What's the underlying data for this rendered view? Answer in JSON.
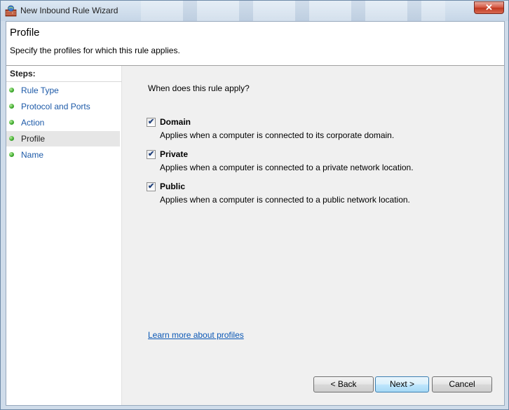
{
  "window": {
    "title": "New Inbound Rule Wizard",
    "close_glyph": "✕"
  },
  "header": {
    "title": "Profile",
    "description": "Specify the profiles for which this rule applies."
  },
  "steps": {
    "label": "Steps:",
    "items": [
      {
        "label": "Rule Type",
        "active": false
      },
      {
        "label": "Protocol and Ports",
        "active": false
      },
      {
        "label": "Action",
        "active": false
      },
      {
        "label": "Profile",
        "active": true
      },
      {
        "label": "Name",
        "active": false
      }
    ]
  },
  "content": {
    "question": "When does this rule apply?",
    "options": [
      {
        "title": "Domain",
        "description": "Applies when a computer is connected to its corporate domain.",
        "checked": true
      },
      {
        "title": "Private",
        "description": "Applies when a computer is connected to a private network location.",
        "checked": true
      },
      {
        "title": "Public",
        "description": "Applies when a computer is connected to a public network location.",
        "checked": true
      }
    ],
    "learn_more_link": "Learn more about profiles",
    "check_glyph": "✔"
  },
  "buttons": {
    "back": "< Back",
    "next": "Next >",
    "cancel": "Cancel"
  }
}
